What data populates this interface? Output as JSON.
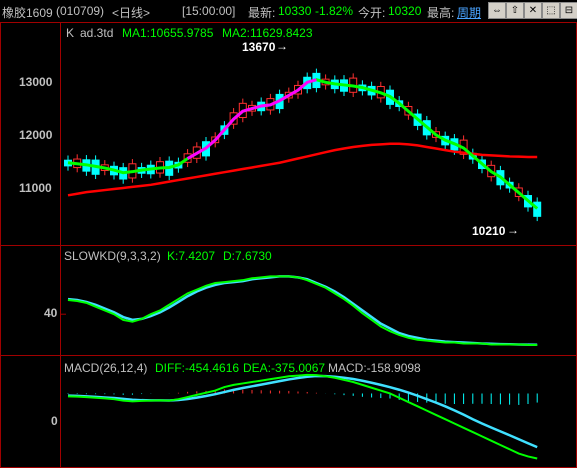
{
  "title": {
    "symbol": "橡胶1609",
    "code": "(010709)",
    "period": "<日线>",
    "time": "[15:00:00]",
    "last_label": "最新:",
    "last_value": "10330",
    "change_pct": "-1.82%",
    "open_label": "今开:",
    "open_value": "10320",
    "high_label": "最高:",
    "high_link": "周期"
  },
  "window_buttons": [
    "⇔",
    "⇧",
    "✕",
    "⬚",
    "⊟"
  ],
  "main_panel": {
    "legend_k": "K",
    "legend_code": "ad.3td",
    "ma1": "MA1:10655.9785",
    "ma2": "MA2:11629.8423",
    "high_label": "13670",
    "low_label": "10210",
    "y_ticks": [
      "13000",
      "12000",
      "11000"
    ]
  },
  "kd_panel": {
    "name": "SLOWKD(9,3,3,2)",
    "k": "K:7.4207",
    "d": "D:7.6730",
    "y_tick": "40"
  },
  "macd_panel": {
    "name": "MACD(26,12,4)",
    "diff": "DIFF:-454.4616",
    "dea": "DEA:-375.0067",
    "macd": "MACD:-158.9098",
    "y_tick": "0"
  },
  "colors": {
    "up": "#ff3030",
    "down": "#00ffff",
    "ma1": "#00ff00",
    "ma2": "#ff0000",
    "accent": "#ff00ff",
    "frame": "#a00000"
  },
  "chart_data": [
    {
      "type": "candlestick",
      "title": "ad.3td",
      "series": [
        {
          "name": "MA1",
          "values": [
            11520,
            11500,
            11480,
            11450,
            11420,
            11380,
            11330,
            11350,
            11380,
            11400,
            11420,
            11430,
            11480,
            11600,
            11700,
            11800,
            11950,
            12150,
            12350,
            12500,
            12550,
            12600,
            12620,
            12700,
            12800,
            12900,
            13050,
            13100,
            13050,
            13020,
            13000,
            12980,
            12950,
            12900,
            12850,
            12780,
            12650,
            12500,
            12350,
            12200,
            12050,
            11950,
            11880,
            11800,
            11650,
            11500,
            11350,
            11250,
            11100,
            10950,
            10800,
            10650
          ]
        },
        {
          "name": "MA2",
          "values": [
            10900,
            10930,
            10960,
            10980,
            11000,
            11020,
            11040,
            11060,
            11080,
            11100,
            11130,
            11160,
            11190,
            11220,
            11250,
            11280,
            11310,
            11340,
            11370,
            11400,
            11430,
            11460,
            11490,
            11520,
            11560,
            11600,
            11640,
            11680,
            11720,
            11760,
            11790,
            11820,
            11840,
            11860,
            11870,
            11880,
            11880,
            11870,
            11850,
            11820,
            11790,
            11760,
            11730,
            11710,
            11690,
            11670,
            11660,
            11650,
            11640,
            11635,
            11630,
            11630
          ]
        }
      ],
      "ylim": [
        10050,
        13950
      ],
      "y_ticks": [
        11000,
        12000,
        13000
      ],
      "annotations": [
        "13670",
        "10210"
      ]
    },
    {
      "type": "line",
      "title": "SLOWKD(9,3,3,2)",
      "series": [
        {
          "name": "K",
          "values": [
            55,
            54,
            52,
            48,
            44,
            40,
            34,
            32,
            35,
            40,
            44,
            50,
            56,
            62,
            66,
            70,
            73,
            74,
            75,
            76,
            78,
            79,
            80,
            80,
            80,
            79,
            76,
            72,
            68,
            62,
            56,
            49,
            41,
            34,
            27,
            22,
            18,
            15,
            13,
            12,
            11,
            10,
            10,
            9,
            9,
            9,
            8,
            8,
            8,
            8,
            7.5,
            7.4
          ]
        },
        {
          "name": "D",
          "values": [
            56,
            55,
            53,
            50,
            46,
            42,
            37,
            34,
            35,
            38,
            42,
            47,
            53,
            59,
            64,
            68,
            71,
            73,
            74,
            75,
            77,
            78,
            79,
            80,
            80,
            79,
            77,
            73,
            69,
            64,
            58,
            51,
            44,
            37,
            30,
            25,
            20,
            17,
            15,
            13,
            12,
            11,
            10.5,
            10,
            9.5,
            9,
            8.7,
            8.4,
            8.2,
            8,
            7.8,
            7.7
          ]
        }
      ],
      "y_ticks": [
        40
      ]
    },
    {
      "type": "line",
      "title": "MACD(26,12,4)",
      "series": [
        {
          "name": "DIFF",
          "values": [
            -20,
            -22,
            -26,
            -30,
            -34,
            -40,
            -50,
            -55,
            -52,
            -50,
            -48,
            -50,
            -40,
            -25,
            -10,
            5,
            20,
            45,
            60,
            70,
            80,
            90,
            100,
            110,
            120,
            125,
            130,
            128,
            120,
            110,
            95,
            80,
            60,
            40,
            20,
            0,
            -30,
            -60,
            -90,
            -120,
            -150,
            -180,
            -210,
            -240,
            -270,
            -300,
            -330,
            -360,
            -390,
            -420,
            -440,
            -454.46
          ]
        },
        {
          "name": "DEA",
          "values": [
            -15,
            -17,
            -20,
            -24,
            -28,
            -32,
            -38,
            -44,
            -47,
            -48,
            -48,
            -49,
            -46,
            -39,
            -29,
            -18,
            -5,
            10,
            25,
            38,
            50,
            62,
            74,
            86,
            98,
            108,
            117,
            122,
            121,
            117,
            110,
            101,
            89,
            75,
            60,
            44,
            26,
            6,
            -16,
            -40,
            -64,
            -90,
            -118,
            -148,
            -180,
            -210,
            -238,
            -265,
            -292,
            -320,
            -348,
            -375.01
          ]
        }
      ],
      "bars": [
        -10,
        -10,
        -12,
        -12,
        -12,
        -16,
        -24,
        -22,
        -10,
        -4,
        0,
        -2,
        12,
        28,
        38,
        46,
        50,
        70,
        70,
        64,
        60,
        56,
        52,
        48,
        44,
        34,
        26,
        12,
        -2,
        -14,
        -30,
        -42,
        -58,
        -70,
        -80,
        -88,
        -112,
        -132,
        -148,
        -160,
        -172,
        -180,
        -184,
        -184,
        -180,
        -180,
        -184,
        -190,
        -196,
        -200,
        -184,
        -158.91
      ],
      "y_ticks": [
        0
      ]
    }
  ]
}
